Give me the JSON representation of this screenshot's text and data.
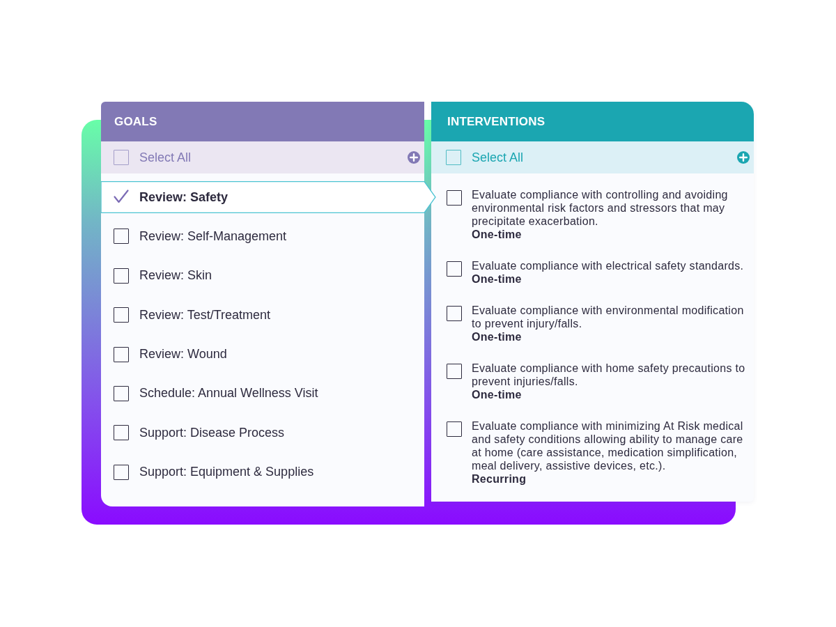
{
  "goals": {
    "title": "GOALS",
    "select_all": {
      "label": "Select All",
      "checked": false
    },
    "items": [
      {
        "label": "Review: Safety",
        "checked": true,
        "selected": true
      },
      {
        "label": "Review: Self-Management",
        "checked": false,
        "selected": false
      },
      {
        "label": "Review: Skin",
        "checked": false,
        "selected": false
      },
      {
        "label": "Review: Test/Treatment",
        "checked": false,
        "selected": false
      },
      {
        "label": "Review: Wound",
        "checked": false,
        "selected": false
      },
      {
        "label": "Schedule: Annual Wellness Visit",
        "checked": false,
        "selected": false
      },
      {
        "label": "Support: Disease Process",
        "checked": false,
        "selected": false
      },
      {
        "label": "Support: Equipment & Supplies",
        "checked": false,
        "selected": false
      }
    ]
  },
  "interventions": {
    "title": "INTERVENTIONS",
    "select_all": {
      "label": "Select All",
      "checked": false
    },
    "items": [
      {
        "text": "Evaluate compliance with controlling and avoiding environmental risk factors and stressors that may precipitate exacerbation.",
        "frequency": "One-time",
        "checked": false
      },
      {
        "text": "Evaluate compliance with electrical safety standards.",
        "frequency": "One-time",
        "checked": false
      },
      {
        "text": "Evaluate compliance with environmental modification to prevent injury/falls.",
        "frequency": "One-time",
        "checked": false
      },
      {
        "text": "Evaluate compliance with home safety precautions to prevent injuries/falls.",
        "frequency": "One-time",
        "checked": false
      },
      {
        "text": "Evaluate compliance with minimizing At Risk medical and safety conditions allowing ability to manage care at home (care assistance, medication simplification, meal delivery, assistive devices, etc.).",
        "frequency": "Recurring",
        "checked": false
      }
    ]
  }
}
